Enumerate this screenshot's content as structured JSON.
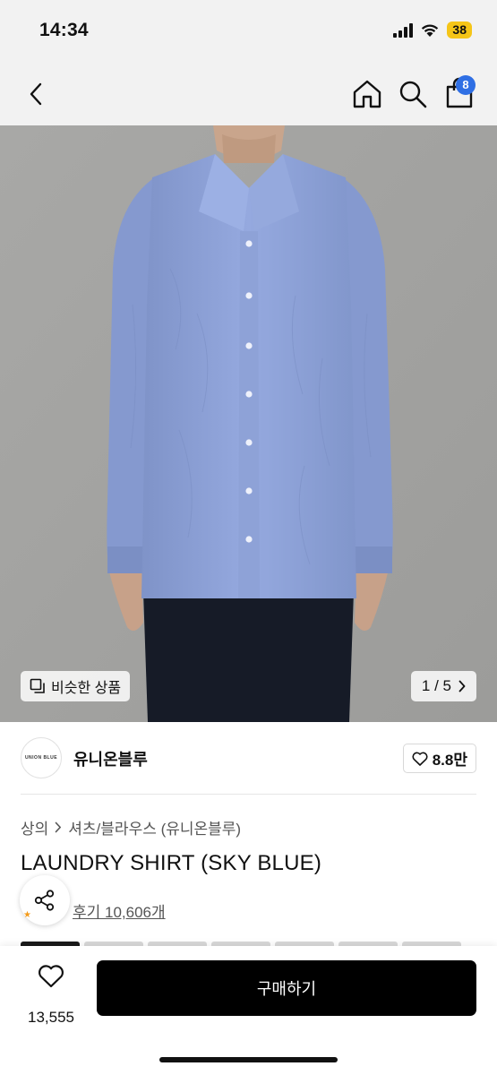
{
  "status": {
    "time": "14:34",
    "battery": "38"
  },
  "nav": {
    "cart_count": "8",
    "icons": [
      "chevron-left-icon",
      "home-icon",
      "search-icon",
      "shopping-bag-icon"
    ]
  },
  "image": {
    "similar_label": "비슷한 상품",
    "page_current": "1",
    "page_total": "5",
    "page_text": "1 / 5"
  },
  "brand": {
    "logo_text": "UNION BLUE",
    "name": "유니온블루",
    "likes": "8.8만"
  },
  "breadcrumb": [
    "상의",
    "셔츠/블라우스 (유니온블루)"
  ],
  "product": {
    "title": "LAUNDRY SHIRT (SKY BLUE)",
    "reviews": "후기 10,606개"
  },
  "bottom": {
    "wish_count": "13,555",
    "buy_label": "구매하기"
  },
  "colors": {
    "accent_badge": "#2f6fe4",
    "buy_button": "#000000",
    "shirt": "#8ea3d9",
    "background_photo": "#a4a4a2"
  }
}
